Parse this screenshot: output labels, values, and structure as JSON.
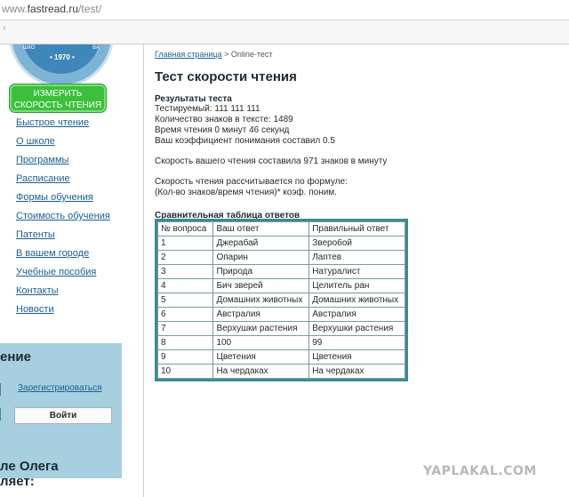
{
  "browser": {
    "url_prefix": "www.",
    "url_host": "fastread.ru",
    "url_path": "/test/"
  },
  "logo": {
    "year": "• 1970 •",
    "text_left": "ШКО",
    "text_right": "ВА"
  },
  "sidebar": {
    "measure_button": "ИЗМЕРИТЬ СКОРОСТЬ ЧТЕНИЯ",
    "nav": [
      "Быстрое чтение",
      "О школе",
      "Программы",
      "Расписание",
      "Формы обучения",
      "Стоимость обучения",
      "Патенты",
      "В вашем городе",
      "Учебные пособия",
      "Контакты",
      "Новости"
    ],
    "login_title": "ение",
    "register_link": "Зарегистрироваться",
    "login_button": "Войти",
    "greeting_line1": "ле Олега",
    "greeting_line2": "ляет:"
  },
  "breadcrumb": {
    "home": "Главная страница",
    "sep": " > ",
    "current": "Online-тест"
  },
  "page": {
    "title": "Тест скорости чтения",
    "results_heading": "Результаты теста",
    "tested": "Тестируемый: 111 111 111",
    "chars": "Количество знаков в тексте: 1489",
    "time": "Время чтения 0 минут 46 секунд",
    "coefficient": "Ваш коэффициент понимания составил 0.5",
    "speed": "Скорость вашего чтения составила 971 знаков в минуту",
    "formula_line1": "Скорость чтения рассчитывается по формуле:",
    "formula_line2": "(Кол-во знаков/время чтения)* коэф. поним.",
    "table_heading": "Сравнительная таблица ответов"
  },
  "table": {
    "headers": [
      "№ вопроса",
      "Ваш ответ",
      "Правильный ответ"
    ],
    "rows": [
      [
        "1",
        "Джерабай",
        "Зверобой"
      ],
      [
        "2",
        "Опарин",
        "Лаптев"
      ],
      [
        "3",
        "Природа",
        "Натуралист"
      ],
      [
        "4",
        "Бич зверей",
        "Целитель ран"
      ],
      [
        "5",
        "Домашних животных",
        "Домашних животных"
      ],
      [
        "6",
        "Австралия",
        "Австралия"
      ],
      [
        "7",
        "Верхушки растения",
        "Верхушки растения"
      ],
      [
        "8",
        "100",
        "99"
      ],
      [
        "9",
        "Цветения",
        "Цветения"
      ],
      [
        "10",
        "На чердаках",
        "На чердаках"
      ]
    ]
  },
  "watermark": "YAPLAKAL.COM"
}
